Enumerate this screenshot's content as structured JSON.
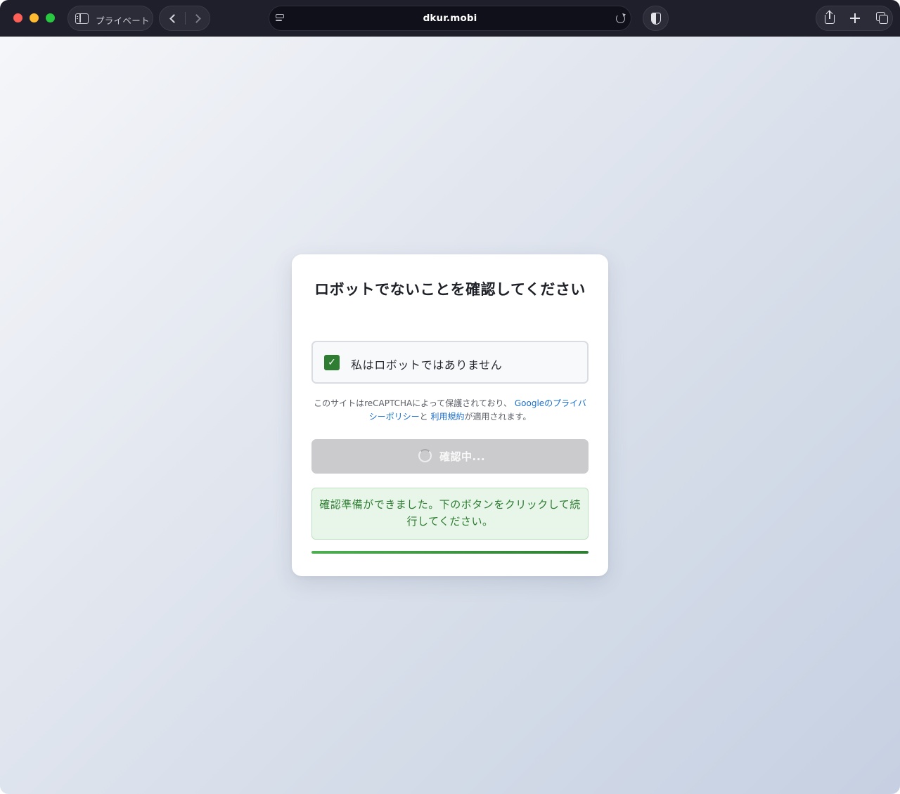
{
  "browser": {
    "private_label": "プライベート",
    "url": "dkur.mobi",
    "icons": {
      "sidebar": "sidebar-icon",
      "back": "chevron-left-icon",
      "forward": "chevron-right-icon",
      "page": "page-menu-icon",
      "reload": "reload-icon",
      "shield": "privacy-shield-icon",
      "share": "share-icon",
      "new_tab": "plus-icon",
      "tabs": "tab-overview-icon"
    }
  },
  "captcha": {
    "title": "ロボットでないことを確認してください",
    "checkbox_label": "私はロボットではありません",
    "checkbox_checked": true,
    "legal_prefix": "このサイトはreCAPTCHAによって保護されており、",
    "privacy_link": "Googleのプライバシーポリシー",
    "legal_mid": "と",
    "terms_link": "利用規約",
    "legal_suffix": "が適用されます。",
    "verify_button": "確認中...",
    "success_message": "確認準備ができました。下のボタンをクリックして続行してください。",
    "progress_percent": 100
  },
  "colors": {
    "accent_green": "#2e7d32",
    "link_blue": "#1a6fce",
    "button_disabled": "#cbcbcd"
  }
}
